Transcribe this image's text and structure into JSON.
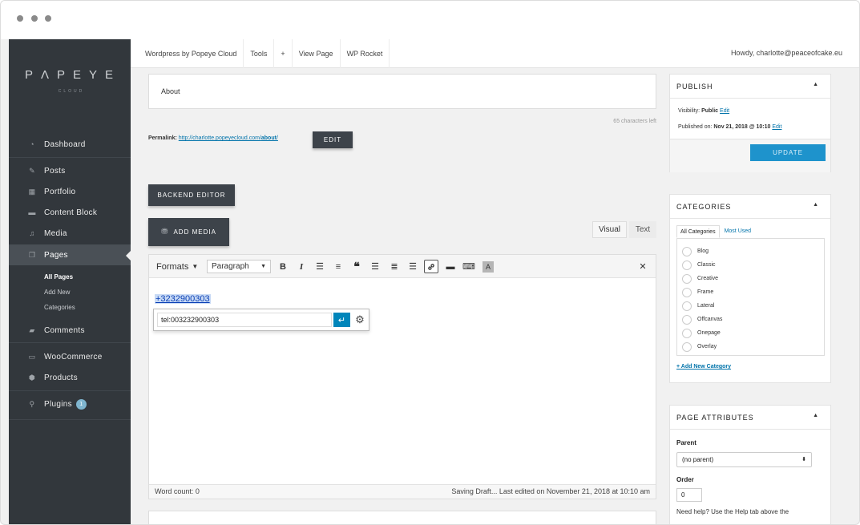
{
  "window": {
    "dots": [
      "window-dot",
      "window-dot",
      "window-dot"
    ]
  },
  "sidebar": {
    "logo": "PɅPEYE",
    "logo_sub": "CLOUD",
    "items": [
      {
        "label": "Dashboard",
        "icon": "dashboard-icon"
      },
      {
        "label": "Posts",
        "icon": "pin-icon"
      },
      {
        "label": "Portfolio",
        "icon": "grid-icon"
      },
      {
        "label": "Content Block",
        "icon": "block-icon"
      },
      {
        "label": "Media",
        "icon": "media-icon"
      },
      {
        "label": "Pages",
        "icon": "pages-icon"
      },
      {
        "label": "Comments",
        "icon": "comment-icon"
      },
      {
        "label": "WooCommerce",
        "icon": "woo-icon"
      },
      {
        "label": "Products",
        "icon": "box-icon"
      },
      {
        "label": "Plugins",
        "icon": "plug-icon",
        "badge": "1"
      }
    ],
    "submenu": [
      "All Pages",
      "Add New",
      "Categories"
    ]
  },
  "topbar": {
    "items": [
      "Wordpress by Popeye Cloud",
      "Tools",
      "+",
      "View Page",
      "WP Rocket"
    ],
    "howdy": "Howdy, charlotte@peaceofcake.eu"
  },
  "editor": {
    "title": "About",
    "char_count": "65 characters left",
    "permalink_label": "Permalink:",
    "permalink_base": "http://charlotte.popeyecloud.com/",
    "permalink_slug": "about",
    "permalink_end": "/",
    "edit_label": "EDIT",
    "backend_editor_label": "BACKEND EDITOR",
    "add_media_label": "ADD MEDIA",
    "tab_visual": "Visual",
    "tab_text": "Text",
    "formats_label": "Formats",
    "paragraph_label": "Paragraph",
    "content_link": "+3232900303",
    "link_url": "tel:003232900303",
    "word_count": "Word count: 0",
    "last_edited": "Saving Draft... Last edited on November 21, 2018 at 10:10 am"
  },
  "publish": {
    "title": "PUBLISH",
    "visibility_label": "Visibility:",
    "visibility_value": "Public",
    "visibility_edit": "Edit",
    "published_label": "Published on:",
    "published_value": "Nov 21, 2018 @ 10:10",
    "published_edit": "Edit",
    "update_label": "UPDATE"
  },
  "categories": {
    "title": "CATEGORIES",
    "tab_all": "All Categories",
    "tab_used": "Most Used",
    "items": [
      "Blog",
      "Classic",
      "Creative",
      "Frame",
      "Lateral",
      "Offcanvas",
      "Onepage",
      "Overlay"
    ],
    "add_new": "+ Add New Category"
  },
  "attributes": {
    "title": "PAGE ATTRIBUTES",
    "parent_label": "Parent",
    "parent_value": "(no parent)",
    "order_label": "Order",
    "order_value": "0",
    "help_text": "Need help? Use the Help tab above the"
  },
  "colors": {
    "sidebar": "#32373c",
    "accent": "#0085ba",
    "update": "#1e93cc"
  }
}
